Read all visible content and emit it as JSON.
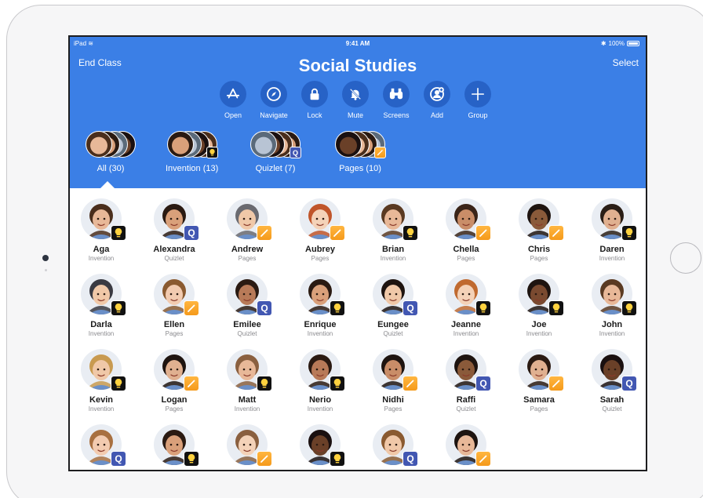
{
  "status_bar": {
    "left": "iPad",
    "time": "9:41 AM",
    "battery": "100%"
  },
  "header": {
    "end_class": "End Class",
    "title": "Social Studies",
    "select": "Select"
  },
  "actions": [
    {
      "label": "Open",
      "icon": "app-store-icon"
    },
    {
      "label": "Navigate",
      "icon": "compass-icon"
    },
    {
      "label": "Lock",
      "icon": "lock-icon"
    },
    {
      "label": "Mute",
      "icon": "mute-bell-icon"
    },
    {
      "label": "Screens",
      "icon": "binoculars-icon"
    },
    {
      "label": "Add",
      "icon": "add-person-icon"
    },
    {
      "label": "Group",
      "icon": "plus-icon"
    }
  ],
  "groups": [
    {
      "label": "All (30)",
      "badge": "none"
    },
    {
      "label": "Invention (13)",
      "badge": "invention"
    },
    {
      "label": "Quizlet (7)",
      "badge": "quizlet"
    },
    {
      "label": "Pages (10)",
      "badge": "pages"
    }
  ],
  "students": [
    {
      "name": "Aga",
      "app": "Invention",
      "badge": "invention",
      "skin": "#e8b898",
      "hair": "#4a2e1c"
    },
    {
      "name": "Alexandra",
      "app": "Quizlet",
      "badge": "quizlet",
      "skin": "#d9a07a",
      "hair": "#2a1a12"
    },
    {
      "name": "Andrew",
      "app": "Pages",
      "badge": "pages",
      "skin": "#f0c8a8",
      "hair": "#6a6a70"
    },
    {
      "name": "Aubrey",
      "app": "Pages",
      "badge": "pages",
      "skin": "#f4d2b8",
      "hair": "#c0552a"
    },
    {
      "name": "Brian",
      "app": "Invention",
      "badge": "invention",
      "skin": "#e8b898",
      "hair": "#5a3a22"
    },
    {
      "name": "Chella",
      "app": "Pages",
      "badge": "pages",
      "skin": "#c98d68",
      "hair": "#3a2418"
    },
    {
      "name": "Chris",
      "app": "Pages",
      "badge": "pages",
      "skin": "#8a5a3a",
      "hair": "#1e1410"
    },
    {
      "name": "Daren",
      "app": "Invention",
      "badge": "invention",
      "skin": "#e0b090",
      "hair": "#2a1e16"
    },
    {
      "name": "Darla",
      "app": "Invention",
      "badge": "invention",
      "skin": "#f0c8a8",
      "hair": "#3a3a42"
    },
    {
      "name": "Ellen",
      "app": "Pages",
      "badge": "pages",
      "skin": "#f2cbb0",
      "hair": "#8a5a30"
    },
    {
      "name": "Emilee",
      "app": "Quizlet",
      "badge": "quizlet",
      "skin": "#b87a58",
      "hair": "#2a1a12"
    },
    {
      "name": "Enrique",
      "app": "Invention",
      "badge": "invention",
      "skin": "#d9a07a",
      "hair": "#2a1a12"
    },
    {
      "name": "Eungee",
      "app": "Quizlet",
      "badge": "quizlet",
      "skin": "#f0c8a8",
      "hair": "#1e1410"
    },
    {
      "name": "Jeanne",
      "app": "Invention",
      "badge": "invention",
      "skin": "#f4d2b8",
      "hair": "#c06a30"
    },
    {
      "name": "Joe",
      "app": "Invention",
      "badge": "invention",
      "skin": "#7a4a30",
      "hair": "#1e1410"
    },
    {
      "name": "John",
      "app": "Invention",
      "badge": "invention",
      "skin": "#e8b898",
      "hair": "#5a3a22"
    },
    {
      "name": "Kevin",
      "app": "Invention",
      "badge": "invention",
      "skin": "#f0c8a8",
      "hair": "#c89a50"
    },
    {
      "name": "Logan",
      "app": "Pages",
      "badge": "pages",
      "skin": "#e0b090",
      "hair": "#1e1410"
    },
    {
      "name": "Matt",
      "app": "Invention",
      "badge": "invention",
      "skin": "#e8b898",
      "hair": "#8a6040"
    },
    {
      "name": "Nerio",
      "app": "Invention",
      "badge": "invention",
      "skin": "#b87a58",
      "hair": "#2a1a12"
    },
    {
      "name": "Nidhi",
      "app": "Pages",
      "badge": "pages",
      "skin": "#c98d68",
      "hair": "#1e1410"
    },
    {
      "name": "Raffi",
      "app": "Quizlet",
      "badge": "quizlet",
      "skin": "#8a5a3a",
      "hair": "#1e1410"
    },
    {
      "name": "Samara",
      "app": "Pages",
      "badge": "pages",
      "skin": "#e0b090",
      "hair": "#2a1a12"
    },
    {
      "name": "Sarah",
      "app": "Quizlet",
      "badge": "quizlet",
      "skin": "#6a4028",
      "hair": "#1a1010"
    },
    {
      "name": "",
      "app": "",
      "badge": "quizlet",
      "skin": "#f2cbb0",
      "hair": "#a87040"
    },
    {
      "name": "",
      "app": "",
      "badge": "invention",
      "skin": "#d9a07a",
      "hair": "#2a1a12"
    },
    {
      "name": "",
      "app": "",
      "badge": "pages",
      "skin": "#f4d2b8",
      "hair": "#8a6040"
    },
    {
      "name": "",
      "app": "",
      "badge": "invention",
      "skin": "#6a4028",
      "hair": "#1a1010"
    },
    {
      "name": "",
      "app": "",
      "badge": "quizlet",
      "skin": "#f0c8a8",
      "hair": "#8a5a30"
    },
    {
      "name": "",
      "app": "",
      "badge": "pages",
      "skin": "#e8b898",
      "hair": "#1e1410"
    }
  ],
  "colors": {
    "header_blue": "#3b7fe6",
    "button_blue": "#2762c6",
    "quizlet": "#4257b2",
    "pages": "#f59a1b",
    "invention": "#111111"
  }
}
